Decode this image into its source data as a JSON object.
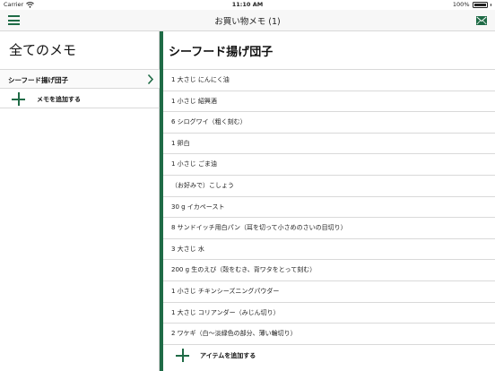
{
  "status_bar": {
    "carrier": "Carrier",
    "time": "11:10 AM",
    "battery": "100%"
  },
  "navbar": {
    "title": "お買い物メモ (1)",
    "menu_icon": "hamburger-menu-icon",
    "mail_icon": "mail-icon",
    "accent_color": "#1f6b46"
  },
  "sidebar": {
    "title": "全てのメモ",
    "items": [
      {
        "label": "シーフード揚げ団子"
      }
    ],
    "add_label": "メモを追加する"
  },
  "main": {
    "title": "シーフード揚げ団子",
    "items": [
      "1 大さじ にんにく油",
      "1 小さじ 紹興酒",
      "6 シログワイ（粗く刻む）",
      "1 卵白",
      "1 小さじ ごま油",
      "（お好みで）こしょう",
      "30 g イカペースト",
      "8 サンドイッチ用白パン（耳を切って小さめのさいの目切り）",
      "3 大さじ 水",
      "200 g 生のえび（殻をむき、背ワタをとって刻む）",
      "1 小さじ チキンシーズニングパウダー",
      "1 大さじ コリアンダー（みじん切り）",
      "2 ワケギ（白〜淡緑色の部分、薄い輪切り）"
    ],
    "add_label": "アイテムを追加する"
  }
}
